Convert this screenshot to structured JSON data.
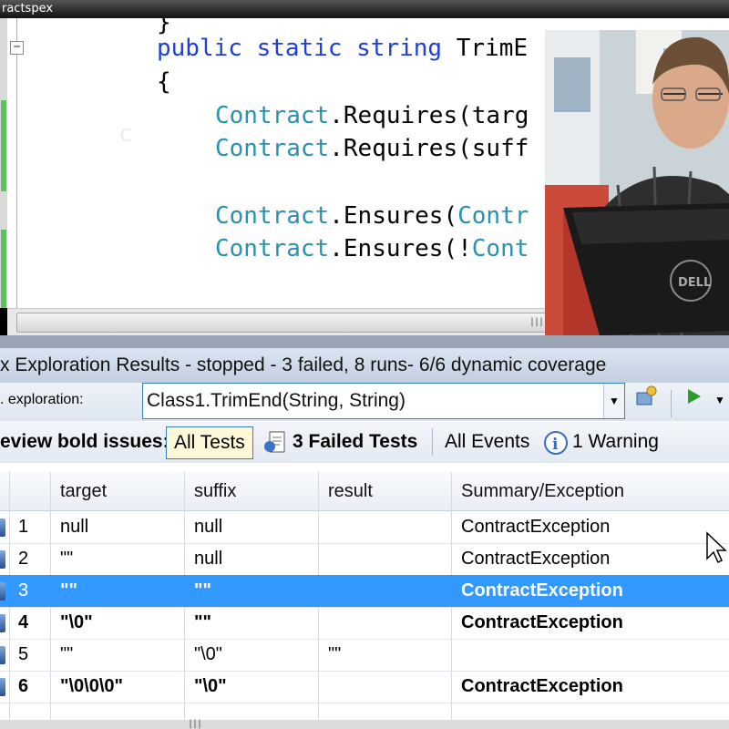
{
  "window_title": "ractspex",
  "code_lines": {
    "l1": "}",
    "l2_kw": "public static string",
    "l2_rest": " TrimE",
    "l3": "{",
    "l4_type": "Contract",
    "l4_rest": ".Requires(targ",
    "l5_type": "Contract",
    "l5_rest": ".Requires(suff",
    "l6_type": "Contract",
    "l6_rest": ".Ensures(",
    "l6_type2": "Contr",
    "l7_type": "Contract",
    "l7_rest": ".Ensures(!",
    "l7_type2": "Cont"
  },
  "collapse_symbol": "−",
  "results_title": "x Exploration Results - stopped - 3 failed, 8 runs- 6/6 dynamic coverage",
  "exploration": {
    "label": ". exploration:",
    "value": "Class1.TrimEnd(String, String)"
  },
  "filters": {
    "review_label": "eview bold issues:",
    "all_tests": "All Tests",
    "failed_tests": "3 Failed Tests",
    "all_events": "All Events",
    "warning": "1 Warning"
  },
  "columns": [
    "target",
    "suffix",
    "result",
    "Summary/Exception"
  ],
  "rows": [
    {
      "num": "1",
      "target": "null",
      "suffix": "null",
      "result": "",
      "summary": "ContractException"
    },
    {
      "num": "2",
      "target": "\"\"",
      "suffix": "null",
      "result": "",
      "summary": "ContractException"
    },
    {
      "num": "3",
      "target": "\"\"",
      "suffix": "\"\"",
      "result": "",
      "summary": "ContractException"
    },
    {
      "num": "4",
      "target": "\"\\0\"",
      "suffix": "\"\"",
      "result": "",
      "summary": "ContractException"
    },
    {
      "num": "5",
      "target": "\"\"",
      "suffix": "\"\\0\"",
      "result": "\"\"",
      "summary": ""
    },
    {
      "num": "6",
      "target": "\"\\0\\0\\0\"",
      "suffix": "\"\\0\"",
      "result": "",
      "summary": "ContractException"
    }
  ],
  "colors": {
    "keyword": "#1f3fd9",
    "type": "#2b91af",
    "selection": "#3399ff",
    "change_marker": "#5bc25b"
  }
}
